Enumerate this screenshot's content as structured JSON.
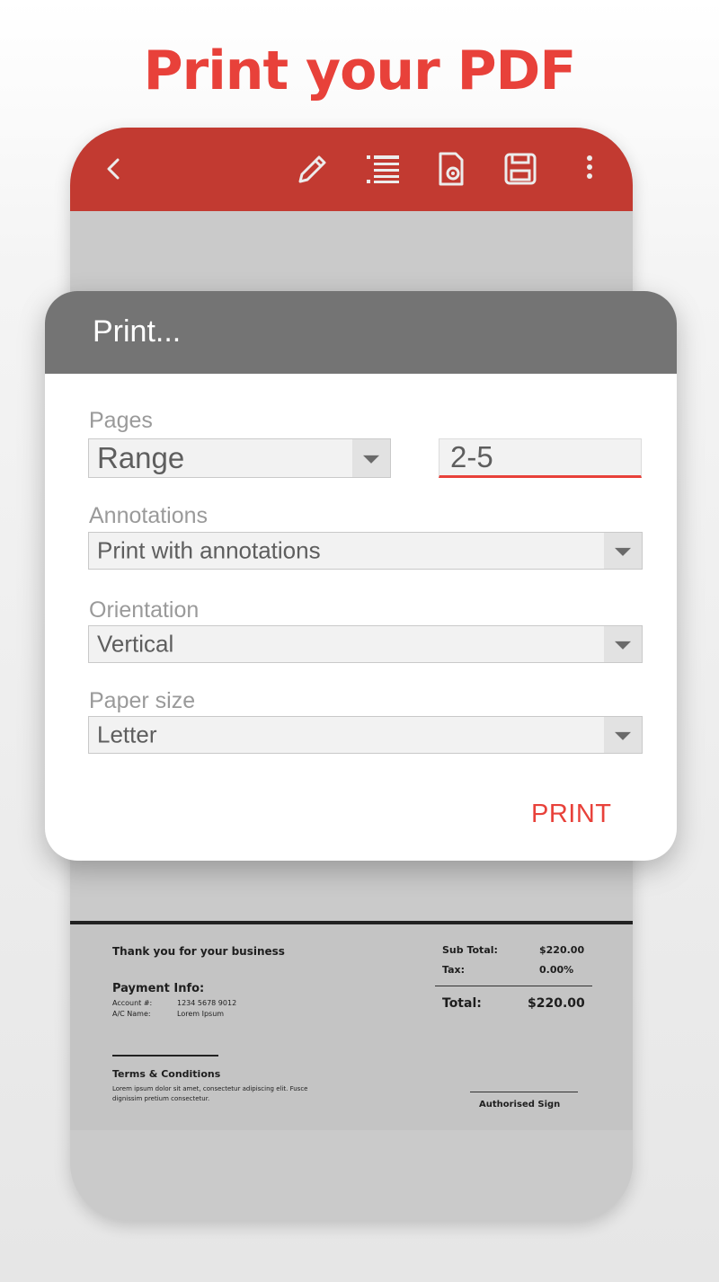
{
  "headline": "Print your PDF",
  "toolbar": {
    "icons": [
      "back-icon",
      "pencil-icon",
      "list-icon",
      "file-settings-icon",
      "save-icon",
      "more-vertical-icon"
    ]
  },
  "dialog": {
    "title": "Print...",
    "pages": {
      "label": "Pages",
      "selected": "Range",
      "range_value": "2-5"
    },
    "annotations": {
      "label": "Annotations",
      "selected": "Print with annotations"
    },
    "orientation": {
      "label": "Orientation",
      "selected": "Vertical"
    },
    "paper_size": {
      "label": "Paper size",
      "selected": "Letter"
    },
    "print_label": "PRINT"
  },
  "invoice": {
    "thanks": "Thank you for your business",
    "payment_title": "Payment Info:",
    "account_label": "Account #:",
    "account_value": "1234 5678 9012",
    "name_label": "A/C Name:",
    "name_value": "Lorem Ipsum",
    "terms_title": "Terms & Conditions",
    "terms_line1": "Lorem ipsum dolor sit amet, consectetur adipiscing elit. Fusce",
    "terms_line2": "dignissim pretium consectetur.",
    "subtotal_label": "Sub Total:",
    "subtotal_value": "$220.00",
    "tax_label": "Tax:",
    "tax_value": "0.00%",
    "total_label": "Total:",
    "total_value": "$220.00",
    "sign_label": "Authorised Sign"
  },
  "colors": {
    "accent": "#e8413a",
    "toolbar": "#c23a31",
    "dialog_header": "#747474"
  }
}
